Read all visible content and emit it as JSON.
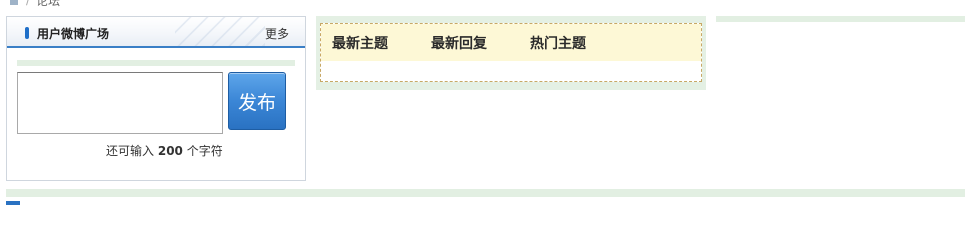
{
  "breadcrumb": {
    "home_icon": "home-icon",
    "separator": "/",
    "current": "论坛"
  },
  "weibo": {
    "title": "用户微博广场",
    "more_label": "更多",
    "textarea_value": "",
    "publish_label": "发布",
    "hint_prefix": "还可输入",
    "hint_count": "200",
    "hint_suffix": "个字符"
  },
  "topics": {
    "tabs": [
      {
        "label": "最新主题"
      },
      {
        "label": "最新回复"
      },
      {
        "label": "热门主题"
      }
    ]
  },
  "colors": {
    "accent_blue": "#2a72c2",
    "strip_green": "#e2efe2",
    "tab_background": "#fdf8d6"
  }
}
